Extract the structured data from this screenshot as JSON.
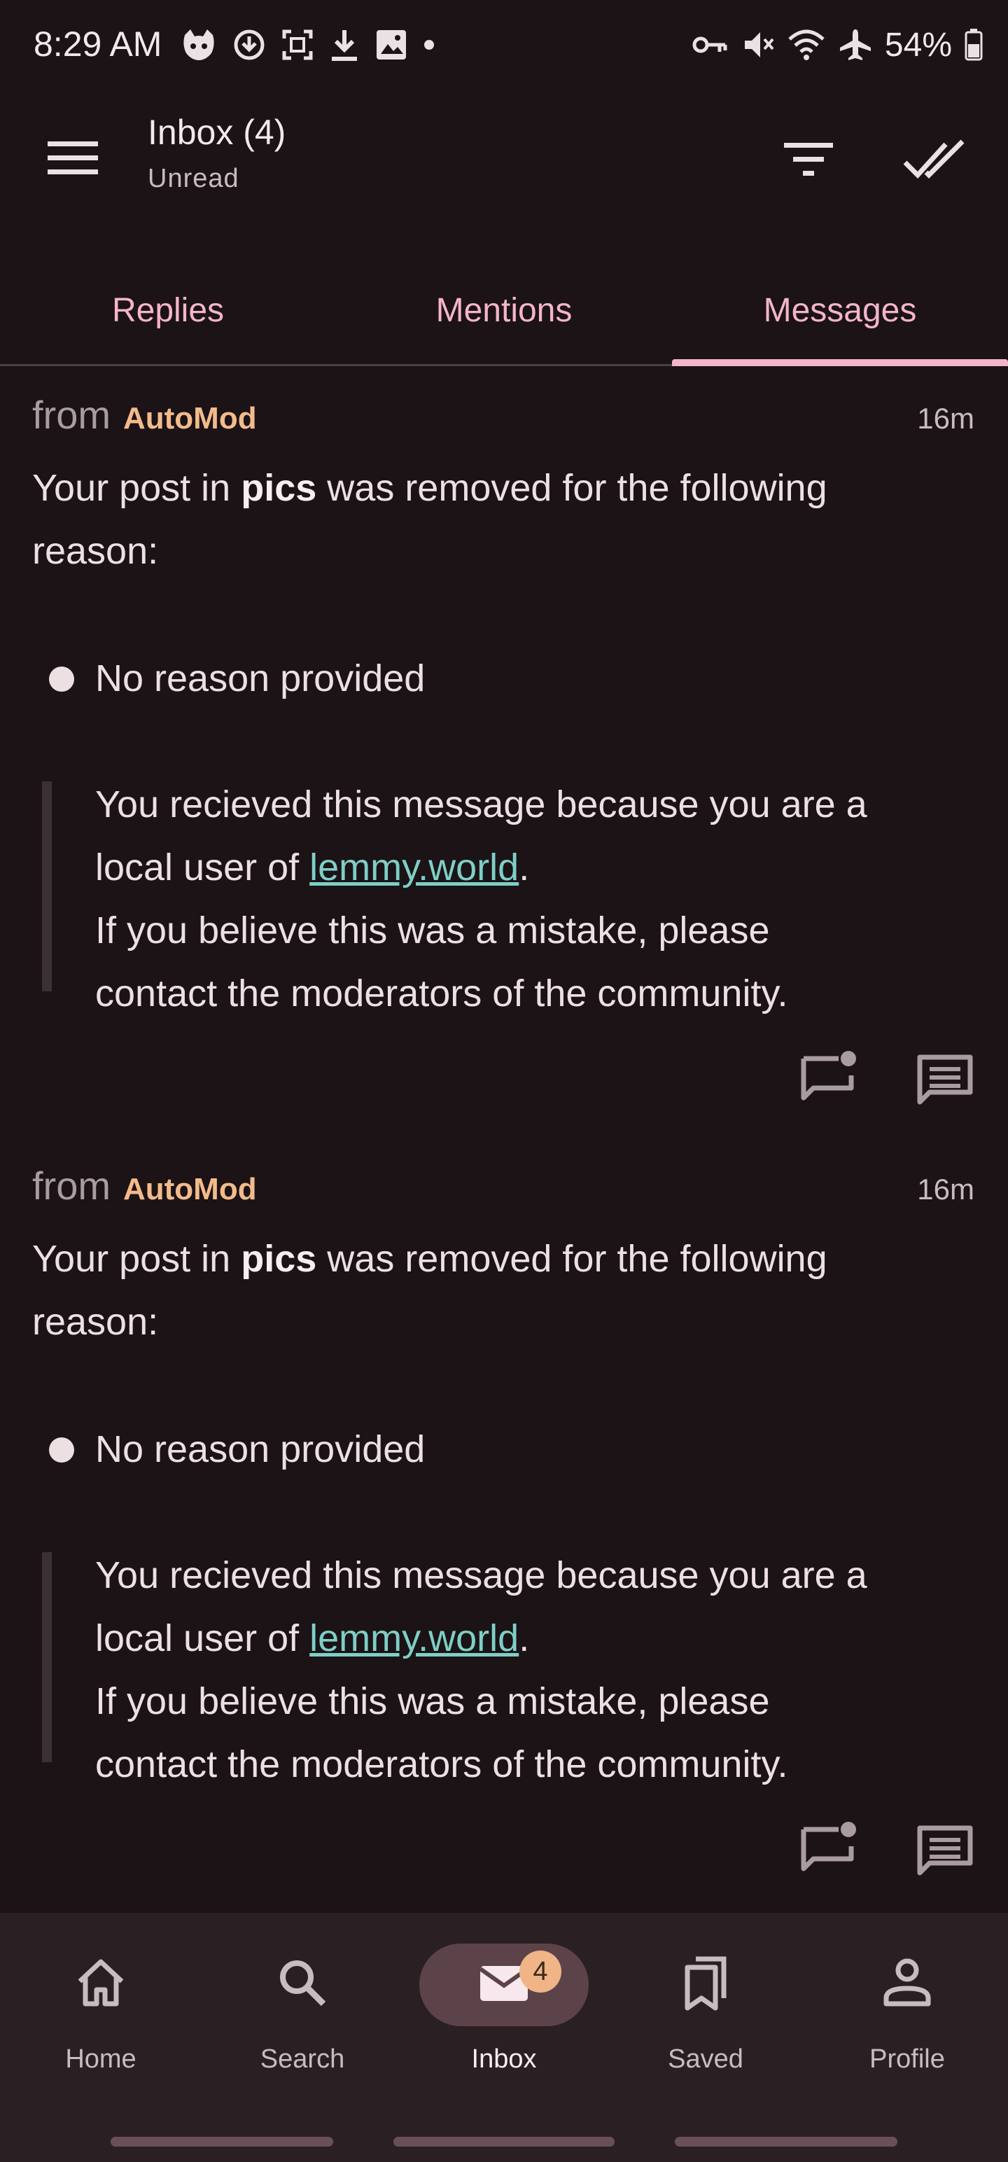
{
  "status_bar": {
    "time": "8:29 AM",
    "battery": "54%",
    "left_icons": [
      "cat-app-icon",
      "download-status-icon",
      "screenshot-icon",
      "download-icon",
      "image-icon",
      "dot-icon"
    ],
    "right_icons": [
      "vpn-key-icon",
      "mute-icon",
      "wifi-icon",
      "airplane-icon",
      "battery-icon"
    ]
  },
  "appbar": {
    "title": "Inbox (4)",
    "subtitle": "Unread"
  },
  "tabs": [
    {
      "label": "Replies",
      "selected": false
    },
    {
      "label": "Mentions",
      "selected": false
    },
    {
      "label": "Messages",
      "selected": true
    }
  ],
  "messages": [
    {
      "from_label": "from",
      "author": "AutoMod",
      "time": "16m",
      "body_prefix": "Your post in ",
      "body_community": "pics",
      "body_suffix": " was removed for the following",
      "body_line2": "reason:",
      "bullet": "No reason provided",
      "quote_line1": "You recieved this message because  you are a",
      "quote_line2_prefix": "local user of ",
      "quote_link": "lemmy.world",
      "quote_line2_suffix": ".",
      "quote_line3": "If you believe this was a mistake, please",
      "quote_line4": "contact the moderators of the community."
    },
    {
      "from_label": "from",
      "author": "AutoMod",
      "time": "16m",
      "body_prefix": "Your post in ",
      "body_community": "pics",
      "body_suffix": " was removed for the following",
      "body_line2": "reason:",
      "bullet": "No reason provided",
      "quote_line1": "You recieved this message because  you are a",
      "quote_line2_prefix": "local user of ",
      "quote_link": "lemmy.world",
      "quote_line2_suffix": ".",
      "quote_line3": "If you believe this was a mistake, please",
      "quote_line4": "contact the moderators of the community."
    }
  ],
  "bottom_nav": {
    "items": [
      {
        "label": "Home",
        "icon": "home-icon",
        "selected": false
      },
      {
        "label": "Search",
        "icon": "search-icon",
        "selected": false
      },
      {
        "label": "Inbox",
        "icon": "mail-icon",
        "selected": true,
        "badge": "4"
      },
      {
        "label": "Saved",
        "icon": "bookmarks-icon",
        "selected": false
      },
      {
        "label": "Profile",
        "icon": "person-icon",
        "selected": false
      }
    ]
  },
  "colors": {
    "background": "#1b1316",
    "accent": "#f4b4cc",
    "author": "#f3bb8b",
    "link": "#7ecfc6",
    "nav_background": "#2a2024",
    "badge": "#f0b486"
  }
}
